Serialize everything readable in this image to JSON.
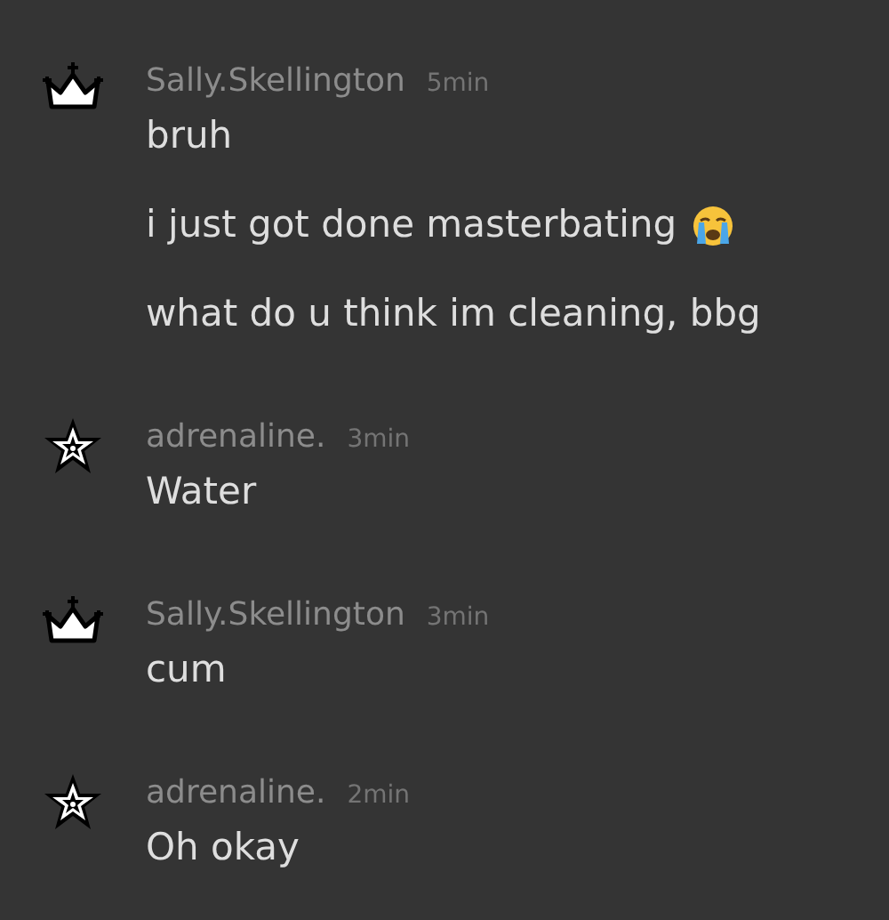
{
  "groups": [
    {
      "kind": "crown",
      "user": "Sally.Skellington",
      "time": "5min",
      "messages": [
        {
          "kind": "plain",
          "text": "bruh"
        },
        {
          "kind": "crying",
          "text": "i just got done masterbating"
        },
        {
          "kind": "plain",
          "text": "what do u think im cleaning, bbg"
        }
      ]
    },
    {
      "kind": "star",
      "user": "adrenaline.",
      "time": "3min",
      "messages": [
        {
          "kind": "plain",
          "text": "Water"
        }
      ]
    },
    {
      "kind": "crown",
      "user": "Sally.Skellington",
      "time": "3min",
      "messages": [
        {
          "kind": "plain",
          "text": "cum"
        }
      ]
    },
    {
      "kind": "star",
      "user": "adrenaline.",
      "time": "2min",
      "messages": [
        {
          "kind": "plain",
          "text": "Oh okay"
        }
      ]
    }
  ]
}
